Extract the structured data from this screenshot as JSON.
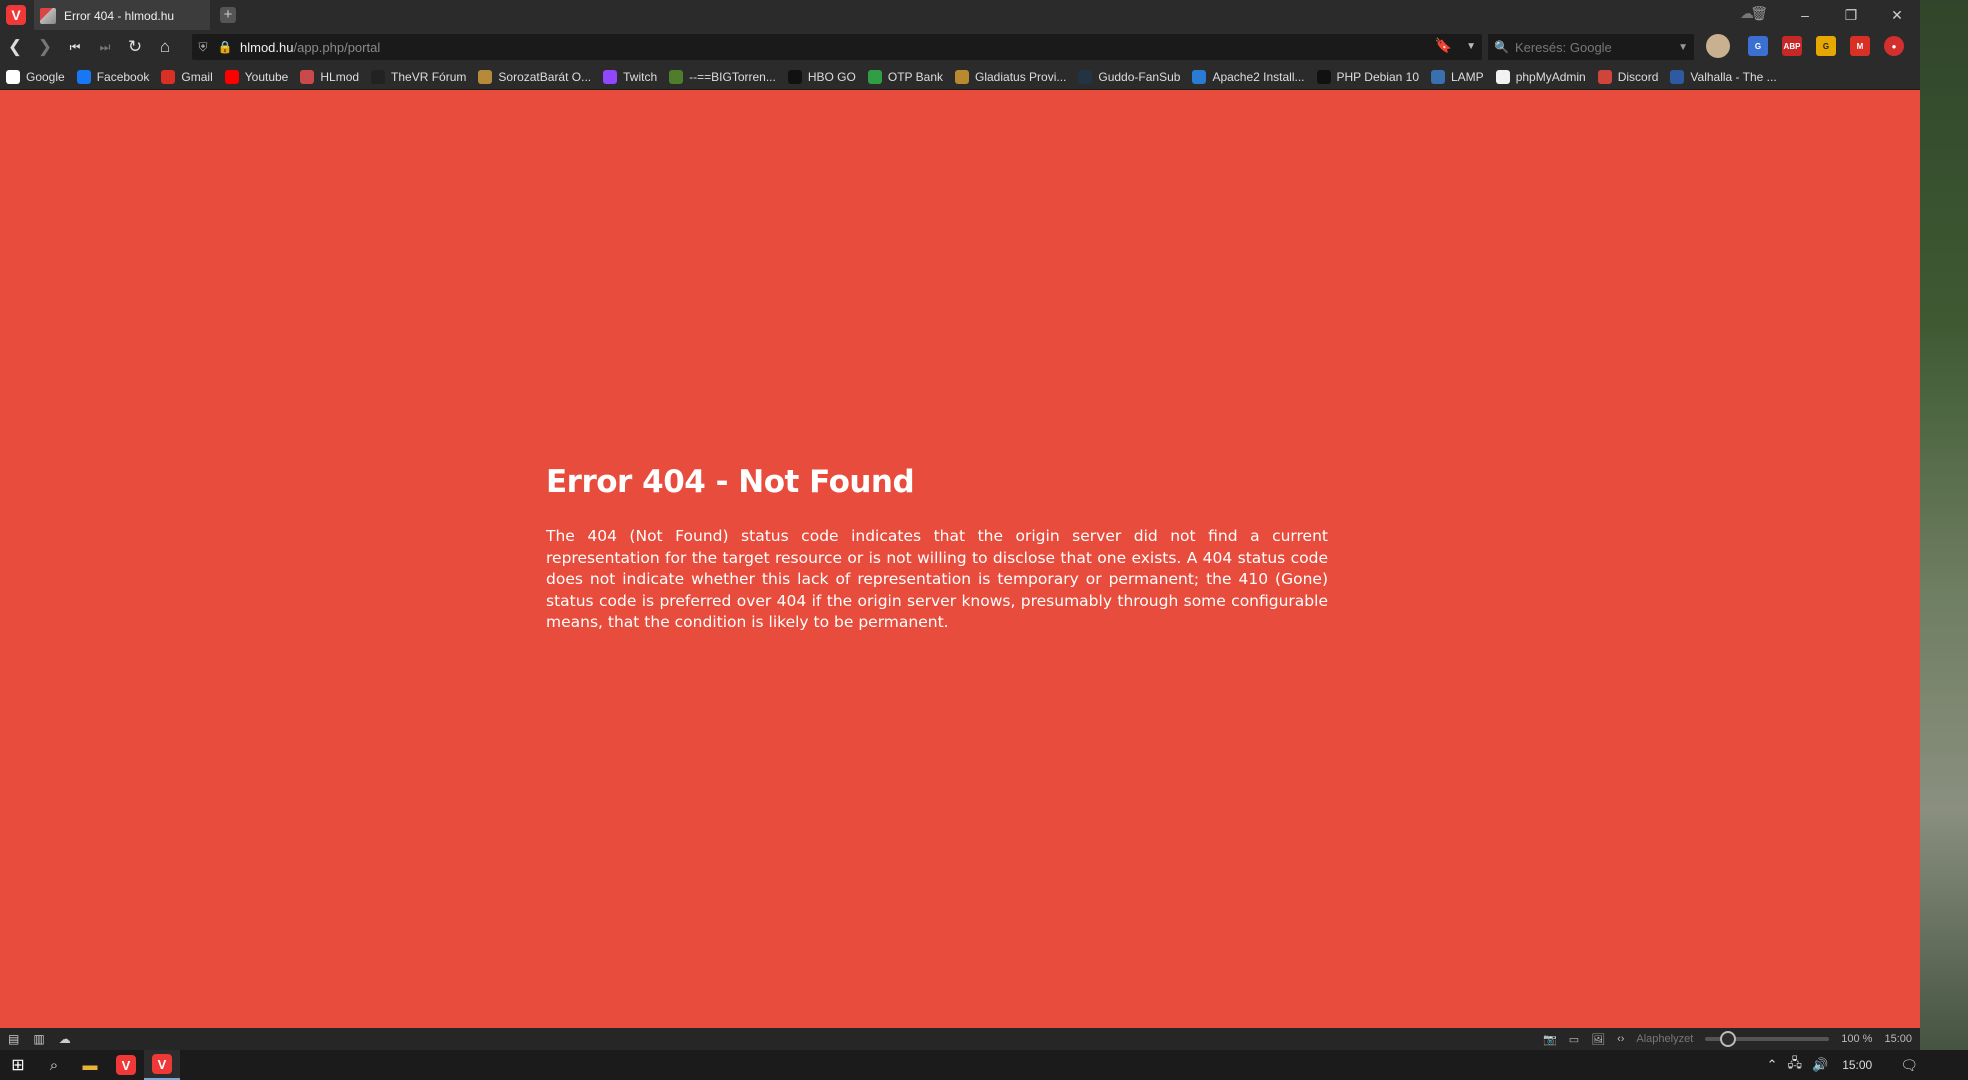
{
  "browser": {
    "tab_title": "Error 404 - hlmod.hu",
    "url_domain": "hlmod.hu",
    "url_path": "/app.php/portal",
    "search_placeholder": "Keresés: Google"
  },
  "window_controls": {
    "minimize": "–",
    "restore": "❐",
    "close": "✕"
  },
  "bookmarks": [
    {
      "label": "Google",
      "color": "#ffffff"
    },
    {
      "label": "Facebook",
      "color": "#1877f2"
    },
    {
      "label": "Gmail",
      "color": "#d93025"
    },
    {
      "label": "Youtube",
      "color": "#ff0000"
    },
    {
      "label": "HLmod",
      "color": "#c94a4a"
    },
    {
      "label": "TheVR Fórum",
      "color": "#222222"
    },
    {
      "label": "SorozatBarát O...",
      "color": "#b58a3a"
    },
    {
      "label": "Twitch",
      "color": "#9146ff"
    },
    {
      "label": "--==BIGTorren...",
      "color": "#4f7d2b"
    },
    {
      "label": "HBO GO",
      "color": "#111111"
    },
    {
      "label": "OTP Bank",
      "color": "#2f9e44"
    },
    {
      "label": "Gladiatus Provi...",
      "color": "#b8892f"
    },
    {
      "label": "Guddo-FanSub",
      "color": "#223344"
    },
    {
      "label": "Apache2 Install...",
      "color": "#2a7bd4"
    },
    {
      "label": "PHP Debian 10",
      "color": "#111111"
    },
    {
      "label": "LAMP",
      "color": "#3a6fb0"
    },
    {
      "label": "phpMyAdmin",
      "color": "#f2f2f2"
    },
    {
      "label": "Discord",
      "color": "#d0453b"
    },
    {
      "label": "Valhalla - The ...",
      "color": "#2d5aa0"
    }
  ],
  "page": {
    "title": "Error 404 - Not Found",
    "text": "The 404 (Not Found) status code indicates that the origin server did not find a current representation for the target resource or is not willing to disclose that one exists. A 404 status code does not indicate whether this lack of representation is temporary or permanent; the 410 (Gone) status code is preferred over 404 if the origin server knows, presumably through some configurable means, that the condition is likely to be permanent.",
    "background": "#e84c3d"
  },
  "statusbar": {
    "reset_label": "Alaphelyzet",
    "zoom": "100 %",
    "zoom_fraction": 0.18,
    "clock": "15:00"
  },
  "taskbar": {
    "clock": "15:00"
  },
  "colors": {
    "vivaldi_red": "#ef3939",
    "chrome_dark": "#2b2b2b"
  }
}
